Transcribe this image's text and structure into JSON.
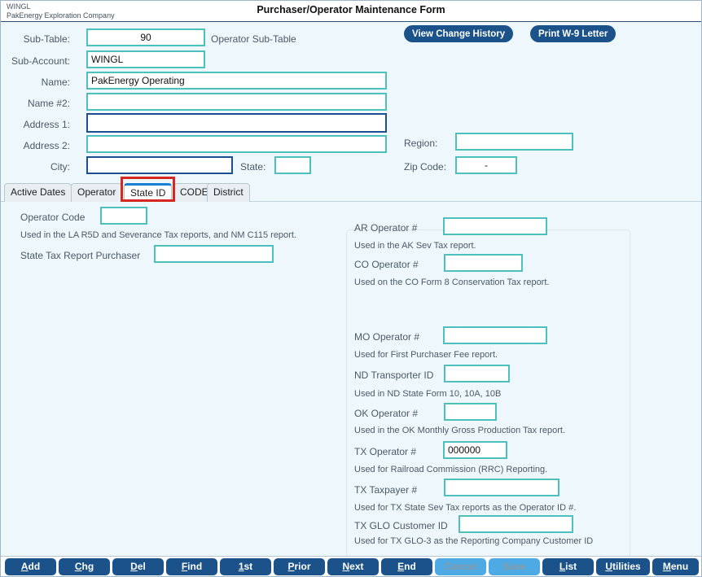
{
  "window": {
    "company_account": "WINGL",
    "company_name": "PakEnergy Exploration Company",
    "title": "Purchaser/Operator Maintenance Form"
  },
  "header_actions": {
    "view_change_history": "View Change History",
    "print_w9_letter": "Print W-9 Letter"
  },
  "form": {
    "sub_table_label": "Sub-Table:",
    "sub_table_value": "90",
    "sub_table_note": "Operator Sub-Table",
    "sub_account_label": "Sub-Account:",
    "sub_account_value": "WINGL",
    "name_label": "Name:",
    "name_value": "PakEnergy Operating",
    "name2_label": "Name #2:",
    "name2_value": "",
    "address1_label": "Address 1:",
    "address1_value": "",
    "address2_label": "Address 2:",
    "address2_value": "",
    "city_label": "City:",
    "city_value": "",
    "state_label": "State:",
    "state_value": "",
    "region_label": "Region:",
    "region_value": "",
    "zip_label": "Zip Code:",
    "zip_value": "-"
  },
  "tabs": [
    {
      "label": "Active Dates",
      "active": false
    },
    {
      "label": "Operator",
      "active": false
    },
    {
      "label": "State ID",
      "active": true
    },
    {
      "label": "CODE",
      "active": false
    },
    {
      "label": "District",
      "active": false
    }
  ],
  "left_fields": [
    {
      "label": "Operator Code",
      "value": "",
      "hint": "Used in the LA R5D and Severance Tax reports, and NM C115 report."
    },
    {
      "label": "State Tax Report Purchaser",
      "value": "",
      "hint": ""
    }
  ],
  "panel_fields": [
    {
      "label": "AR Operator #",
      "value": "",
      "hint": "Used in the AK Sev Tax report."
    },
    {
      "label": "CO Operator #",
      "value": "",
      "hint": "Used on the CO Form 8 Conservation Tax report."
    },
    {
      "label": "MO Operator #",
      "value": "",
      "hint": "Used for First Purchaser Fee report."
    },
    {
      "label": "ND Transporter ID",
      "value": "",
      "hint": "Used in ND State Form 10, 10A, 10B"
    },
    {
      "label": "OK Operator #",
      "value": "",
      "hint": "Used in the OK Monthly Gross Production Tax report."
    },
    {
      "label": "TX Operator #",
      "value": "000000",
      "hint": "Used for Railroad Commission (RRC) Reporting."
    },
    {
      "label": "TX Taxpayer #",
      "value": "",
      "hint": "Used for TX State Sev Tax reports as the Operator ID #."
    },
    {
      "label": "TX GLO Customer ID",
      "value": "",
      "hint": "Used for TX GLO-3 as the Reporting Company Customer ID"
    }
  ],
  "toolbar": [
    {
      "accel": "A",
      "rest": "dd",
      "disabled": false
    },
    {
      "accel": "C",
      "rest": "hg",
      "disabled": false
    },
    {
      "accel": "D",
      "rest": "el",
      "disabled": false
    },
    {
      "accel": "F",
      "rest": "ind",
      "disabled": false
    },
    {
      "accel": "1",
      "rest": "st",
      "disabled": false
    },
    {
      "accel": "P",
      "rest": "rior",
      "disabled": false
    },
    {
      "accel": "N",
      "rest": "ext",
      "disabled": false
    },
    {
      "accel": "E",
      "rest": "nd",
      "disabled": false
    },
    {
      "accel": "C",
      "rest": "ancel",
      "disabled": true
    },
    {
      "accel": "S",
      "rest": "ave",
      "disabled": true
    },
    {
      "accel": "L",
      "rest": "ist",
      "disabled": false
    },
    {
      "accel": "U",
      "rest": "tilities",
      "disabled": false
    },
    {
      "accel": "M",
      "rest": "enu",
      "disabled": false
    }
  ],
  "colors": {
    "field_border": "#4cc0bd",
    "focus_border": "#1c4f8f",
    "button_blue": "#1a5289",
    "disabled_blue": "#4eaae4",
    "tab_accent": "#1b7fd4",
    "highlight_red": "#d4291f",
    "page_bg": "#eef7fb"
  }
}
